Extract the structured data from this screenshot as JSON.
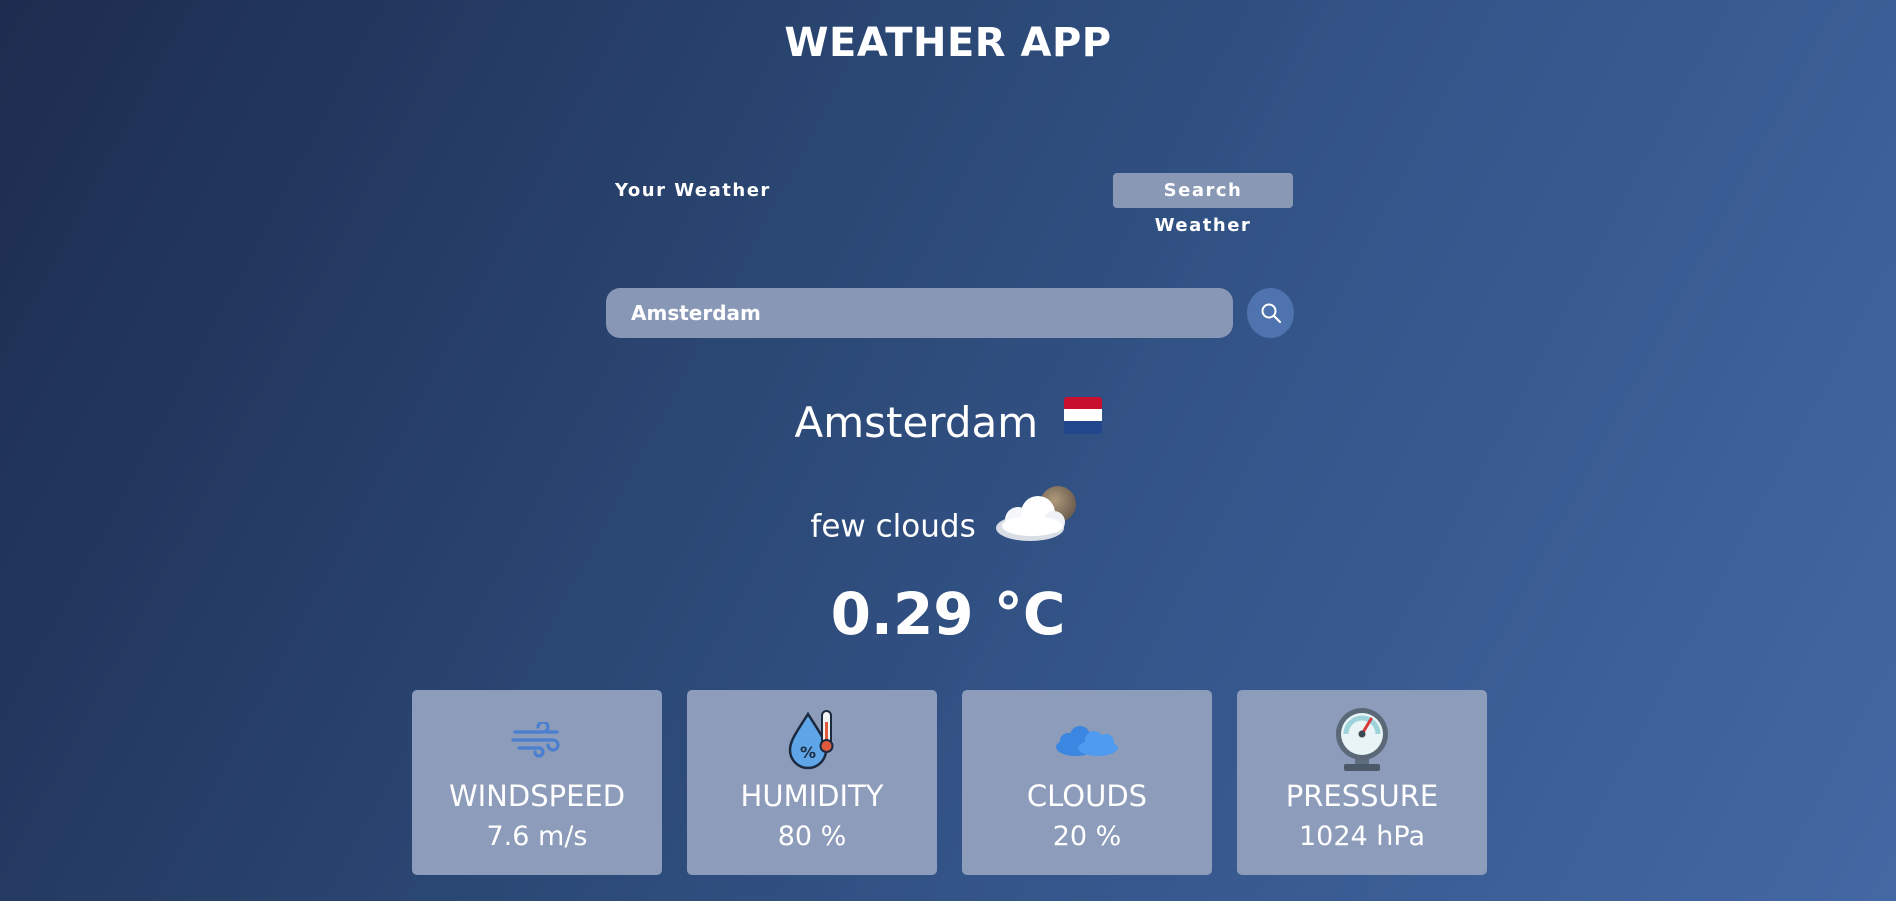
{
  "app": {
    "title": "WEATHER APP"
  },
  "tabs": {
    "your_weather": "Your Weather",
    "search_weather": "Search Weather"
  },
  "search": {
    "value": "Amsterdam",
    "placeholder": "",
    "button_icon": "search-icon"
  },
  "location": {
    "city": "Amsterdam",
    "flag_icon": "netherlands-flag-icon"
  },
  "current": {
    "description": "few clouds",
    "description_icon": "few-clouds-icon",
    "temperature": "0.29 °C"
  },
  "stats": [
    {
      "label": "WINDSPEED",
      "value": "7.6 m/s",
      "icon": "wind-icon"
    },
    {
      "label": "HUMIDITY",
      "value": "80 %",
      "icon": "humidity-icon"
    },
    {
      "label": "CLOUDS",
      "value": "20 %",
      "icon": "clouds-icon"
    },
    {
      "label": "PRESSURE",
      "value": "1024 hPa",
      "icon": "pressure-gauge-icon"
    }
  ],
  "colors": {
    "accent": "#4e73ae",
    "panel": "#8c9cba",
    "input": "#8897b5",
    "tab_active": "#8998b5",
    "text": "#ffffff"
  }
}
